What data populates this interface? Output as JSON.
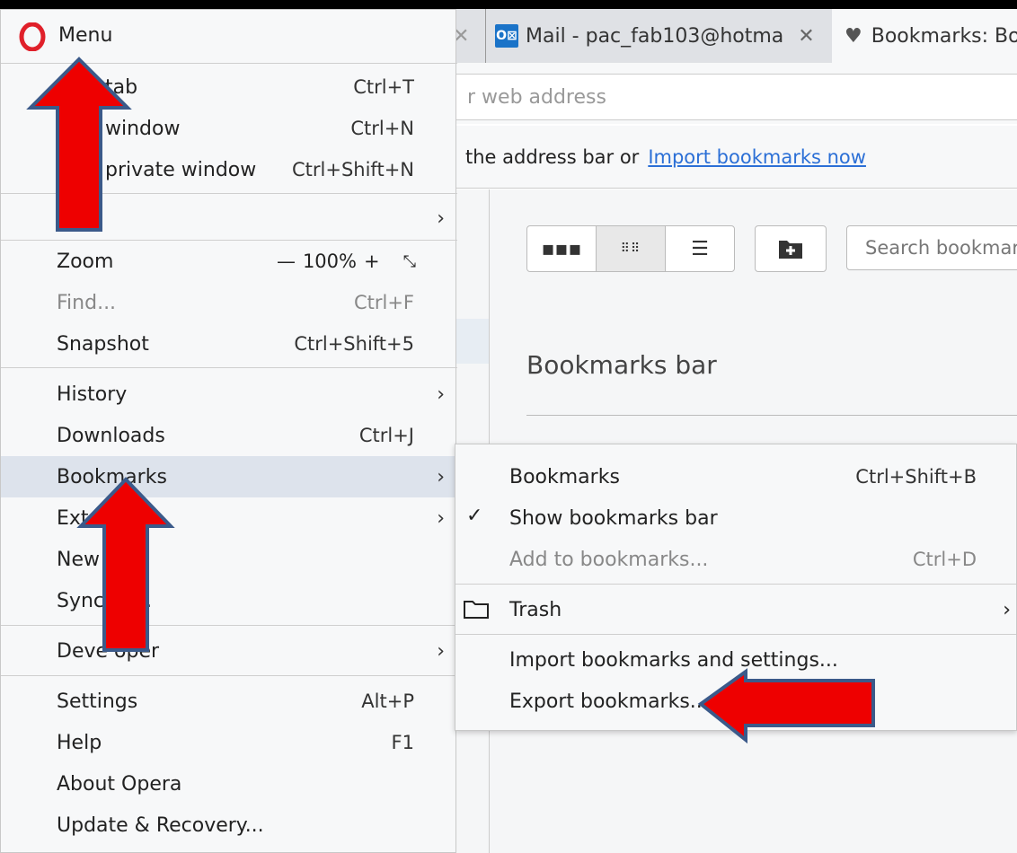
{
  "tabs": {
    "mail": "Mail - pac_fab103@hotma",
    "bookmarks": "Bookmarks: Bo"
  },
  "address": {
    "placeholder_visible": "r web address"
  },
  "import_bar": {
    "text": "the address bar or",
    "link": "Import bookmarks now"
  },
  "bookmarks_page": {
    "search_placeholder": "Search bookmar",
    "section_title": "Bookmarks bar"
  },
  "menu": {
    "title": "Menu",
    "items": [
      {
        "label": "tab",
        "shortcut": "Ctrl+T"
      },
      {
        "label": "window",
        "shortcut": "Ctrl+N"
      },
      {
        "label": "private window",
        "shortcut": "Ctrl+Shift+N"
      },
      {
        "label": "e"
      },
      {
        "label": "Zoom",
        "zoom_value": "100%"
      },
      {
        "label": "Find...",
        "shortcut": "Ctrl+F"
      },
      {
        "label": "Snapshot",
        "shortcut": "Ctrl+Shift+5"
      },
      {
        "label": "History"
      },
      {
        "label": "Downloads",
        "shortcut": "Ctrl+J"
      },
      {
        "label": "Bookmarks"
      },
      {
        "label": "Ext"
      },
      {
        "label": "New"
      },
      {
        "label": "Sync ze..."
      },
      {
        "label": "Deve oper"
      },
      {
        "label": "Settings",
        "shortcut": "Alt+P"
      },
      {
        "label": "Help",
        "shortcut": "F1"
      },
      {
        "label": "About Opera"
      },
      {
        "label": "Update & Recovery..."
      }
    ]
  },
  "submenu": {
    "items": [
      {
        "label": "Bookmarks",
        "shortcut": "Ctrl+Shift+B"
      },
      {
        "label": "Show bookmarks bar"
      },
      {
        "label": "Add to bookmarks...",
        "shortcut": "Ctrl+D"
      },
      {
        "label": "Trash"
      },
      {
        "label": "Import bookmarks and settings..."
      },
      {
        "label": "Export bookmarks..."
      }
    ]
  },
  "colors": {
    "arrow_fill": "#ee0000",
    "arrow_stroke": "#3b5a8a",
    "link": "#2b6fd6",
    "highlight": "#dde3ec",
    "opera_red": "#e0202a"
  },
  "icons": [
    "opera-logo-icon",
    "outlook-icon",
    "heart-icon",
    "close-icon",
    "grid-large-icon",
    "grid-small-icon",
    "list-icon",
    "new-folder-icon",
    "chevron-right-icon",
    "checkmark-icon",
    "folder-icon",
    "minimize-icon"
  ]
}
